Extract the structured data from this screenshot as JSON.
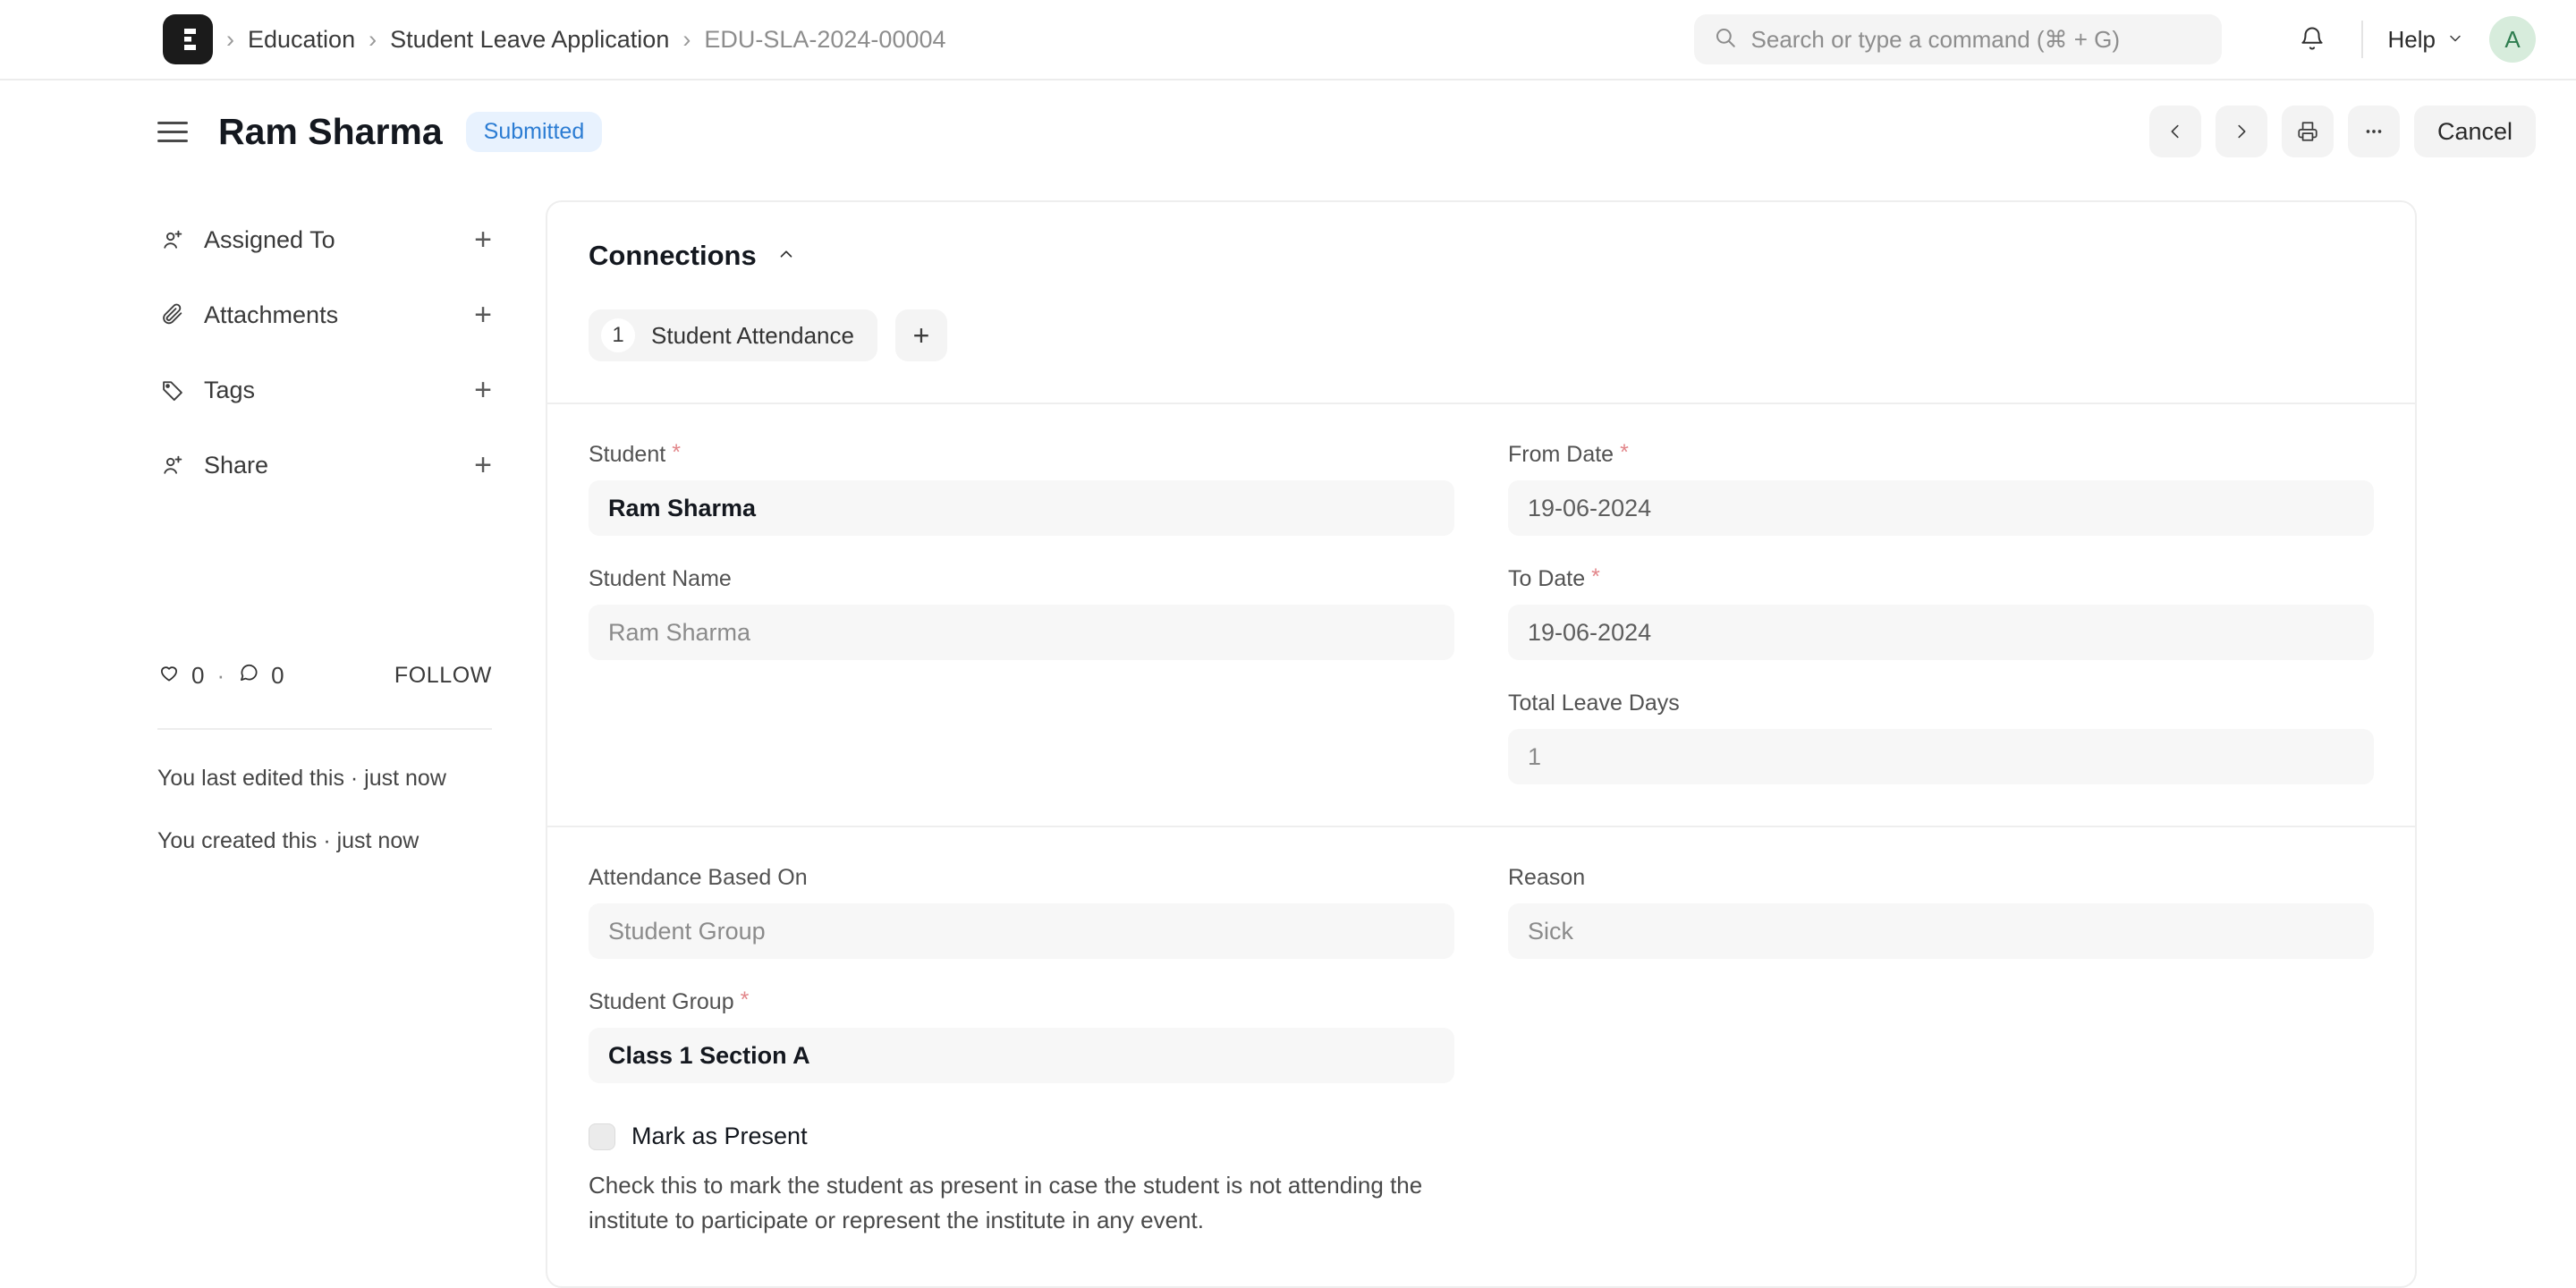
{
  "navbar": {
    "logo_icon": "erpnext-logo-icon",
    "breadcrumbs": [
      {
        "label": "Education",
        "muted": false
      },
      {
        "label": "Student Leave Application",
        "muted": false
      },
      {
        "label": "EDU-SLA-2024-00004",
        "muted": true
      }
    ],
    "separator": "›",
    "search": {
      "icon": "search-icon",
      "placeholder": "Search or type a command (⌘ + G)",
      "value": ""
    },
    "notifications_icon": "bell-icon",
    "help_label": "Help",
    "help_chevron_icon": "chevron-down-icon",
    "avatar_initial": "A"
  },
  "page_header": {
    "menu_icon": "hamburger-menu-icon",
    "title": "Ram Sharma",
    "status": "Submitted",
    "status_color": "#2b7cd3",
    "status_bg": "#e8f2fe",
    "toolbar": {
      "prev_icon": "chevron-left-icon",
      "next_icon": "chevron-right-icon",
      "print_icon": "printer-icon",
      "more_icon": "ellipsis-icon",
      "cancel_label": "Cancel"
    }
  },
  "sidebar": {
    "items": [
      {
        "label": "Assigned To",
        "icon": "user-plus-icon",
        "action": "+"
      },
      {
        "label": "Attachments",
        "icon": "paperclip-icon",
        "action": "+"
      },
      {
        "label": "Tags",
        "icon": "tag-icon",
        "action": "+"
      },
      {
        "label": "Share",
        "icon": "user-plus-icon",
        "action": "+"
      }
    ],
    "social": {
      "like_icon": "heart-icon",
      "like_count": "0",
      "dot": "·",
      "comment_icon": "comment-icon",
      "comment_count": "0",
      "follow_label": "FOLLOW"
    },
    "notes": [
      "You last edited this · just now",
      "You created this · just now"
    ]
  },
  "connections": {
    "title": "Connections",
    "collapse_icon": "chevron-up-icon",
    "items": [
      {
        "count": "1",
        "label": "Student Attendance"
      }
    ],
    "add_label": "+"
  },
  "form": {
    "section_1": {
      "left": [
        {
          "label": "Student",
          "required": true,
          "value": "Ram Sharma",
          "style": "strong"
        },
        {
          "label": "Student Name",
          "required": false,
          "value": "Ram Sharma",
          "style": "muted"
        }
      ],
      "right": [
        {
          "label": "From Date",
          "required": true,
          "value": "19-06-2024",
          "style": "value"
        },
        {
          "label": "To Date",
          "required": true,
          "value": "19-06-2024",
          "style": "value"
        },
        {
          "label": "Total Leave Days",
          "required": false,
          "value": "1",
          "style": "muted"
        }
      ]
    },
    "section_2": {
      "left": [
        {
          "label": "Attendance Based On",
          "required": false,
          "value": "Student Group",
          "style": "muted"
        },
        {
          "label": "Student Group",
          "required": true,
          "value": "Class 1 Section A",
          "style": "strong"
        }
      ],
      "right": [
        {
          "label": "Reason",
          "required": false,
          "value": "Sick",
          "style": "muted"
        }
      ],
      "checkbox": {
        "label": "Mark as Present",
        "checked": false,
        "help": "Check this to mark the student as present in case the student is not attending the institute to participate or represent the institute in any event."
      }
    },
    "required_marker": "*"
  }
}
